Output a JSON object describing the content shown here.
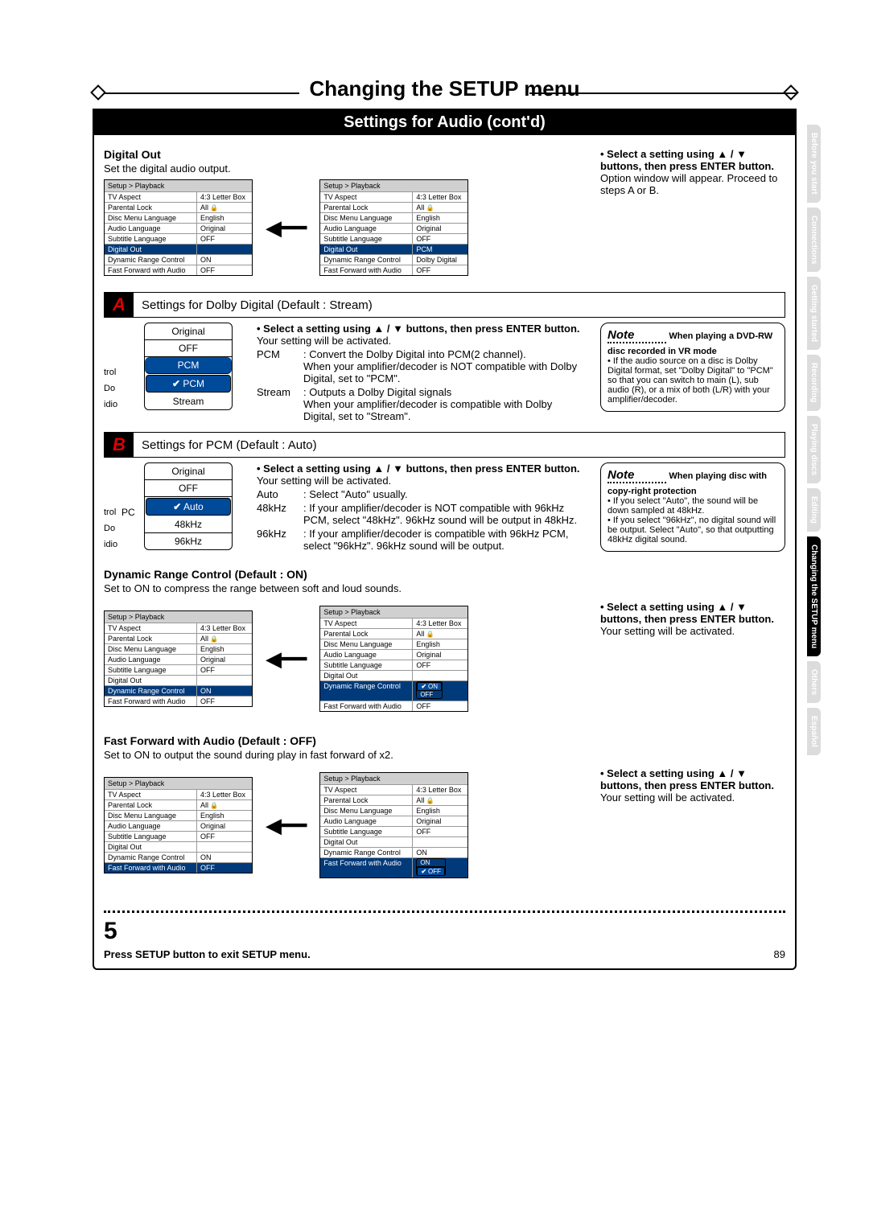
{
  "page_number": "89",
  "main_title": "Changing the SETUP  menu",
  "subtitle": "Settings for Audio (cont'd)",
  "side_tabs": [
    "Before you start",
    "Connections",
    "Getting started",
    "Recording",
    "Playing discs",
    "Editing",
    "Changing the SETUP menu",
    "Others",
    "Español"
  ],
  "side_tabs_active_index": 6,
  "digital_out": {
    "heading": "Digital Out",
    "desc": "Set the digital audio output.",
    "right_bold": "• Select a setting using ▲ / ▼ buttons, then press ENTER button.",
    "right_text": "Option window will appear. Proceed to steps A or B."
  },
  "setup_crumb": "Setup > Playback",
  "setup_rows_base": [
    {
      "k": "TV Aspect",
      "v": "4:3 Letter Box"
    },
    {
      "k": "Parental Lock",
      "v": "All"
    },
    {
      "k": "Disc Menu Language",
      "v": "English"
    },
    {
      "k": "Audio Language",
      "v": "Original"
    },
    {
      "k": "Subtitle Language",
      "v": "OFF"
    },
    {
      "k": "Digital Out",
      "v": ""
    },
    {
      "k": "Dynamic Range Control",
      "v": "ON"
    },
    {
      "k": "Fast Forward with Audio",
      "v": "OFF"
    }
  ],
  "setup_digital_right": [
    {
      "k": "TV Aspect",
      "v": "4:3 Letter Box"
    },
    {
      "k": "Parental Lock",
      "v": "All"
    },
    {
      "k": "Disc Menu Language",
      "v": "English"
    },
    {
      "k": "Audio Language",
      "v": "Original"
    },
    {
      "k": "Subtitle Language",
      "v": "OFF"
    },
    {
      "k": "Digital Out",
      "v": "PCM"
    },
    {
      "k": "Dynamic Range Control",
      "v": "Dolby Digital"
    },
    {
      "k": "Fast Forward with Audio",
      "v": "OFF"
    }
  ],
  "A": {
    "letter": "A",
    "heading": "Settings for Dolby Digital (Default : Stream)",
    "popup": {
      "items": [
        "Original",
        "OFF",
        "PCM",
        "PCM",
        "Stream"
      ],
      "blue_index": 2,
      "sel_index": 3,
      "edge": [
        "trol",
        "Do",
        "idio"
      ],
      "edge2": "Do"
    },
    "desc_bold": "• Select a setting using ▲ / ▼ buttons, then press ENTER button.",
    "desc_activated": "Your setting will be activated.",
    "pcm_label": "PCM",
    "pcm_text": ": Convert the Dolby Digital into PCM(2 channel).\nWhen your amplifier/decoder is NOT compatible with Dolby Digital, set to \"PCM\".",
    "stream_label": "Stream",
    "stream_text": ": Outputs a Dolby Digital signals\nWhen your amplifier/decoder is compatible with Dolby Digital, set to \"Stream\".",
    "note_head": "Note",
    "note_bold": "When playing a DVD-RW disc recorded in VR mode",
    "note_body": "If the audio source on a disc is Dolby Digital format, set \"Dolby Digital\" to \"PCM\" so that you can switch to main (L), sub audio (R), or a mix of both (L/R) with your amplifier/decoder."
  },
  "B": {
    "letter": "B",
    "heading": "Settings for PCM (Default : Auto)",
    "popup": {
      "items": [
        "Original",
        "OFF",
        "Auto",
        "48kHz",
        "96kHz"
      ],
      "sel_index": 2,
      "label_left": "PC",
      "edge": [
        "trol",
        "Do",
        "idio"
      ]
    },
    "desc_bold": "• Select a setting using ▲ / ▼ buttons, then press ENTER button.",
    "desc_activated": "Your setting will be activated.",
    "auto_label": "Auto",
    "auto_text": ": Select \"Auto\" usually.",
    "k48_label": "48kHz",
    "k48_text": ": If your amplifier/decoder is NOT compatible with 96kHz PCM, select \"48kHz\". 96kHz sound will be output in 48kHz.",
    "k96_label": "96kHz",
    "k96_text": ": If your amplifier/decoder is compatible with 96kHz PCM, select \"96kHz\". 96kHz sound will be output.",
    "note_head": "Note",
    "note_bold": "When playing disc with copy-right protection",
    "note_li1": "If you select \"Auto\", the sound will be down sampled at 48kHz.",
    "note_li2": "If you select \"96kHz\", no digital sound will be output. Select \"Auto\", so that outputting 48kHz digital sound."
  },
  "drc": {
    "heading": "Dynamic Range Control (Default : ON)",
    "desc": "Set to ON to compress the range between soft and loud sounds.",
    "right_bold": "• Select a setting using ▲ / ▼ buttons, then press ENTER button.",
    "right_text": "Your setting will be activated.",
    "popup_items": [
      "ON",
      "OFF"
    ],
    "popup_sel": "ON"
  },
  "ffa": {
    "heading": "Fast Forward with Audio (Default : OFF)",
    "desc": "Set to ON to output the sound during play in fast forward of x2.",
    "right_bold": "• Select a setting using ▲ / ▼ buttons, then press ENTER button.",
    "right_text": "Your setting will be activated.",
    "popup_items": [
      "ON",
      "OFF"
    ],
    "popup_sel": "OFF"
  },
  "step_num": "5",
  "step_text": "Press SETUP button to exit SETUP menu."
}
